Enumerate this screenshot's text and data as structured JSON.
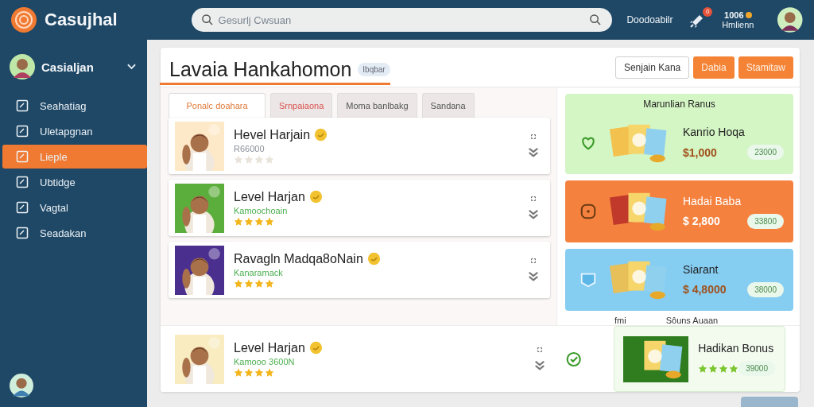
{
  "app": {
    "name": "Casujhal"
  },
  "search": {
    "placeholder": "Gesurlj Cwsuan"
  },
  "topbar": {
    "link": "Doodoabilr",
    "notification_count": "0",
    "coins": "1006",
    "coins_label": "Hmlienn"
  },
  "sidebar": {
    "user": "Casialjan",
    "items": [
      {
        "label": "Seahatiag",
        "selected": false
      },
      {
        "label": "Uletapgnan",
        "selected": false
      },
      {
        "label": "Lieple",
        "selected": true
      },
      {
        "label": "Ubtidge",
        "selected": false
      },
      {
        "label": "Vagtal",
        "selected": false
      },
      {
        "label": "Seadakan",
        "selected": false
      }
    ]
  },
  "panel": {
    "title": "Lavaia Hankahomon",
    "tag": "Ibqbar",
    "buttons": [
      {
        "label": "Senjain Kana",
        "kind": "outline"
      },
      {
        "label": "Dabia",
        "kind": "primary"
      },
      {
        "label": "Stamitaw",
        "kind": "primary"
      }
    ]
  },
  "tabs": [
    {
      "label": "Ponalc doahara",
      "selected": true,
      "color": "#e07a3a"
    },
    {
      "label": "Srnpaiaona",
      "selected": false,
      "color": "#d9534f"
    },
    {
      "label": "Moma banlbakg",
      "selected": false,
      "color": "#555555"
    },
    {
      "label": "Sandana",
      "selected": false,
      "color": "#555555"
    }
  ],
  "games": [
    {
      "title": "Hevel Harjain",
      "subtitle": "R66000",
      "color": "#8a8f99",
      "stars": 0
    },
    {
      "title": "Level Harjan",
      "subtitle": "Kamoochoain",
      "color": "#4caf50",
      "stars": 4
    },
    {
      "title": "Ravagln Madqa8oNain",
      "subtitle": "Kanaramack",
      "color": "#4caf50",
      "stars": 4
    },
    {
      "title": "Level Harjan",
      "subtitle": "Kamooo 3600N",
      "color": "#4caf50",
      "stars": 4
    }
  ],
  "bonus": {
    "title": "Marunlian Ranus",
    "section_note": "fmi",
    "section_title": "Sôuns Auaan",
    "cards": [
      {
        "kind": "price",
        "title": "Kanrio Hoqa",
        "price": "$1,000",
        "pill": "23000",
        "color": "#d4f5c4"
      },
      {
        "kind": "price",
        "title": "Hadai Baba",
        "price": "$ 2,800",
        "pill": "33800",
        "color": "#f5813f"
      },
      {
        "kind": "price",
        "title": "Siarant",
        "price": "$ 4,8000",
        "pill": "38000",
        "color": "#86cdf2"
      },
      {
        "kind": "stars",
        "title": "Hadikan Bonus",
        "stars": 4,
        "pill": "39000",
        "color": "#f3fbef"
      }
    ]
  }
}
